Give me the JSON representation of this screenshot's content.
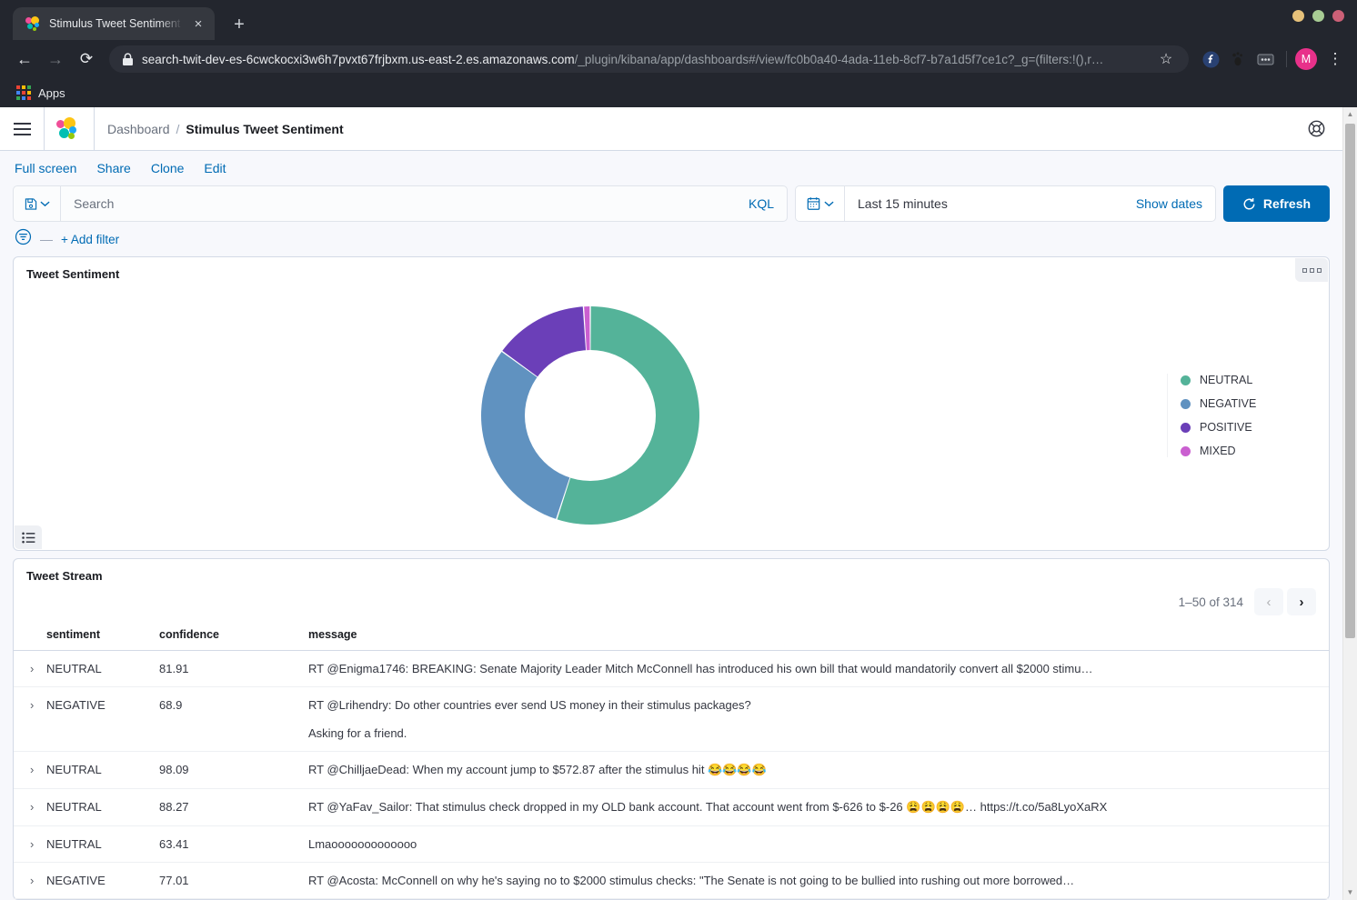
{
  "browser": {
    "tab": {
      "title": "Stimulus Tweet Sentiment",
      "close_label": "×",
      "favicon_name": "elastic-favicon"
    },
    "new_tab_label": "+",
    "window_buttons": [
      "#e6c17a",
      "#a8cc94",
      "#cc6077"
    ],
    "nav": {
      "back": "←",
      "forward": "→",
      "reload": "⟳"
    },
    "url": {
      "domain": "search-twit-dev-es-6cwckocxi3w6h7pvxt67frjbxm.us-east-2.es.amazonaws.com",
      "path": "/_plugin/kibana/app/dashboards#/view/fc0b0a40-4ada-11eb-8cf7-b7a1d5f7ce1c?_g=(filters:!(),r…"
    },
    "star_label": "☆",
    "profile_initial": "M",
    "menu_label": "⋮",
    "bookmarks": {
      "apps_label": "Apps"
    }
  },
  "kibana": {
    "breadcrumb": {
      "parent": "Dashboard",
      "separator": "/",
      "current": "Stimulus Tweet Sentiment"
    },
    "toolbar": [
      {
        "label": "Full screen",
        "name": "full-screen-link"
      },
      {
        "label": "Share",
        "name": "share-link"
      },
      {
        "label": "Clone",
        "name": "clone-link"
      },
      {
        "label": "Edit",
        "name": "edit-link"
      }
    ],
    "query": {
      "search_placeholder": "Search",
      "search_value": "",
      "language": "KQL",
      "date_range": "Last 15 minutes",
      "show_dates": "Show dates",
      "refresh": "Refresh",
      "add_filter": "+ Add filter",
      "filter_dash": "—"
    }
  },
  "chart_panel": {
    "title": "Tweet Sentiment",
    "menu_name": "panel-context-menu",
    "legend_toggle_name": "legend-toggle-button"
  },
  "chart_data": {
    "type": "pie",
    "title": "Tweet Sentiment",
    "donut": true,
    "legend_position": "right",
    "labels": [
      "NEUTRAL",
      "NEGATIVE",
      "POSITIVE",
      "MIXED"
    ],
    "values": [
      55.0,
      30.0,
      14.0,
      1.0
    ],
    "colors": [
      "#54b399",
      "#6092c0",
      "#6b3fb8",
      "#ca5fd0"
    ]
  },
  "table_panel": {
    "title": "Tweet Stream",
    "pagination": {
      "summary": "1–50 of 314",
      "prev_label": "‹",
      "next_label": "›"
    },
    "columns": [
      "sentiment",
      "confidence",
      "message"
    ],
    "rows": [
      {
        "expand": "›",
        "sentiment": "NEUTRAL",
        "confidence": "81.91",
        "message_lines": [
          "RT @Enigma1746: BREAKING: Senate Majority Leader Mitch McConnell has introduced his own bill that would mandatorily convert all $2000 stimu…"
        ]
      },
      {
        "expand": "›",
        "sentiment": "NEGATIVE",
        "confidence": "68.9",
        "message_lines": [
          "RT @Lrihendry: Do other countries ever send US money in their stimulus packages?",
          "Asking for a friend."
        ]
      },
      {
        "expand": "›",
        "sentiment": "NEUTRAL",
        "confidence": "98.09",
        "message_lines": [
          "RT @ChilljaeDead: When my account jump to $572.87 after the stimulus hit 😂😂😂😂"
        ]
      },
      {
        "expand": "›",
        "sentiment": "NEUTRAL",
        "confidence": "88.27",
        "message_lines": [
          "RT @YaFav_Sailor: That stimulus check dropped in my OLD bank account. That account went from $-626 to $-26 😩😩😩😩… https://t.co/5a8LyoXaRX"
        ]
      },
      {
        "expand": "›",
        "sentiment": "NEUTRAL",
        "confidence": "63.41",
        "message_lines": [
          "Lmaooooooooooooo"
        ]
      },
      {
        "expand": "›",
        "sentiment": "NEGATIVE",
        "confidence": "77.01",
        "message_lines": [
          "RT @Acosta: McConnell on why he's saying no to $2000 stimulus checks: \"The Senate is not going to be bullied into rushing out more borrowed…"
        ]
      }
    ]
  }
}
